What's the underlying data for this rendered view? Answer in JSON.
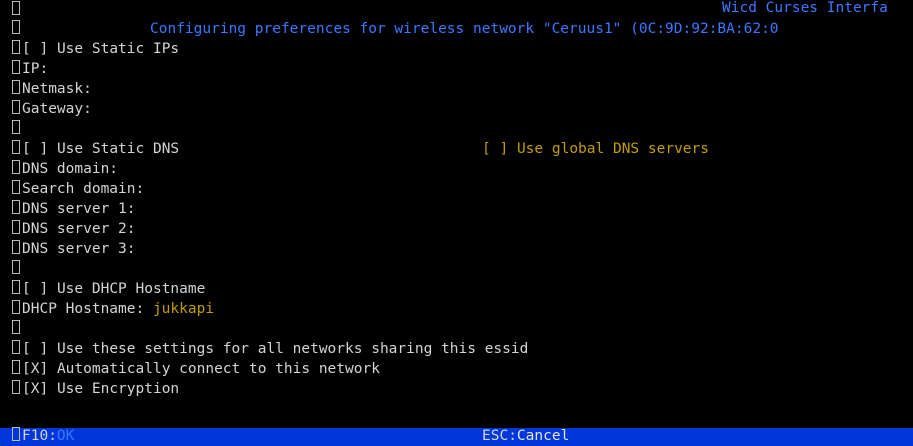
{
  "header": {
    "app_title": "Wicd Curses Interfa",
    "subtitle": "Configuring preferences for wireless network \"Ceruus1\" (0C:9D:92:BA:62:0"
  },
  "form": {
    "static_ip_checkbox": "[ ]",
    "static_ip_label": "Use Static IPs",
    "ip_label": "IP:",
    "netmask_label": "Netmask:",
    "gateway_label": "Gateway:",
    "static_dns_checkbox": "[ ]",
    "static_dns_label": "Use Static DNS",
    "global_dns_checkbox": "[ ]",
    "global_dns_label": "Use global DNS servers",
    "dns_domain_label": "DNS domain:",
    "search_domain_label": "Search domain:",
    "dns1_label": "DNS server 1:",
    "dns2_label": "DNS server 2:",
    "dns3_label": "DNS server 3:",
    "dhcp_hostname_checkbox": "[ ]",
    "dhcp_hostname_check_label": "Use DHCP Hostname",
    "dhcp_hostname_label": "DHCP Hostname:",
    "dhcp_hostname_value": "jukkapi",
    "share_settings_checkbox": "[ ]",
    "share_settings_label": "Use these settings for all networks sharing this essid",
    "auto_connect_checkbox": "[X]",
    "auto_connect_label": "Automatically connect to this network",
    "encryption_checkbox": "[X]",
    "encryption_label": "Use Encryption"
  },
  "footer": {
    "ok_key": "F10:",
    "ok_label": "OK",
    "cancel_key": "ESC:",
    "cancel_label": "Cancel"
  },
  "colors": {
    "background": "#000000",
    "text": "#d4d4d4",
    "accent_blue": "#3b78ff",
    "value_yellow": "#c19c00",
    "footer_bar": "#0037da"
  }
}
